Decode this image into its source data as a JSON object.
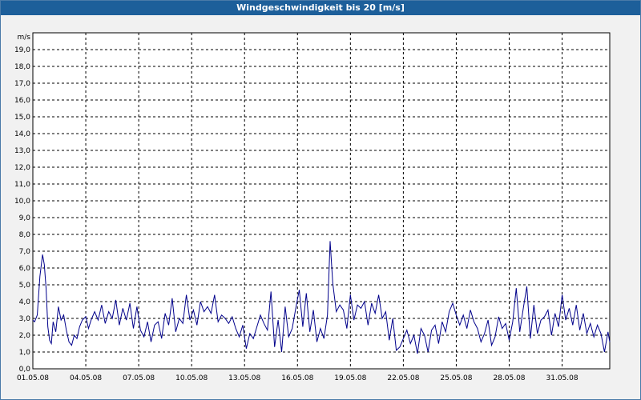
{
  "window": {
    "title": "Windgeschwindigkeit bis 20 [m/s]"
  },
  "chart_data": {
    "type": "line",
    "title": "Windgeschwindigkeit bis 20 [m/s]",
    "ylabel": "m/s",
    "xlabel": "",
    "ylim": [
      0,
      20
    ],
    "xlim_days": [
      0,
      32.7
    ],
    "grid": true,
    "line_color": "#00008b",
    "y_ticks": [
      "0,0",
      "1,0",
      "2,0",
      "3,0",
      "4,0",
      "5,0",
      "6,0",
      "7,0",
      "8,0",
      "9,0",
      "10,0",
      "11,0",
      "12,0",
      "13,0",
      "14,0",
      "15,0",
      "16,0",
      "17,0",
      "18,0",
      "19,0"
    ],
    "x_ticks": [
      "01.05.08",
      "04.05.08",
      "07.05.08",
      "10.05.08",
      "13.05.08",
      "16.05.08",
      "19.05.08",
      "22.05.08",
      "25.05.08",
      "28.05.08",
      "31.05.08"
    ],
    "x_tick_days": [
      0,
      3,
      6,
      9,
      12,
      15,
      18,
      21,
      24,
      27,
      30
    ],
    "series": [
      {
        "x": [
          0,
          0.1,
          0.25,
          0.4,
          0.55,
          0.65,
          0.75,
          0.85,
          0.95,
          1.05,
          1.15,
          1.3,
          1.45,
          1.6,
          1.75,
          1.9,
          2.05,
          2.2,
          2.35,
          2.5,
          2.65,
          2.8,
          3.0,
          3.15,
          3.3,
          3.5,
          3.7,
          3.9,
          4.1,
          4.3,
          4.5,
          4.7,
          4.9,
          5.1,
          5.3,
          5.5,
          5.7,
          5.9,
          6.1,
          6.3,
          6.5,
          6.7,
          6.9,
          7.1,
          7.3,
          7.5,
          7.7,
          7.9,
          8.1,
          8.3,
          8.5,
          8.7,
          8.9,
          9.1,
          9.3,
          9.5,
          9.7,
          9.9,
          10.1,
          10.3,
          10.5,
          10.7,
          10.9,
          11.1,
          11.3,
          11.5,
          11.7,
          11.9,
          12.1,
          12.3,
          12.5,
          12.7,
          12.9,
          13.1,
          13.3,
          13.5,
          13.7,
          13.9,
          14.1,
          14.3,
          14.5,
          14.7,
          14.9,
          15.1,
          15.3,
          15.5,
          15.7,
          15.9,
          16.1,
          16.3,
          16.5,
          16.7,
          16.85,
          17.0,
          17.2,
          17.4,
          17.6,
          17.8,
          18.0,
          18.2,
          18.4,
          18.6,
          18.8,
          19.0,
          19.2,
          19.4,
          19.6,
          19.8,
          20.0,
          20.2,
          20.4,
          20.6,
          20.8,
          21.0,
          21.2,
          21.4,
          21.6,
          21.8,
          22.0,
          22.2,
          22.4,
          22.6,
          22.8,
          23.0,
          23.2,
          23.4,
          23.6,
          23.8,
          24.0,
          24.2,
          24.4,
          24.6,
          24.8,
          25.0,
          25.2,
          25.4,
          25.6,
          25.8,
          26.0,
          26.2,
          26.4,
          26.6,
          26.8,
          27.0,
          27.2,
          27.4,
          27.6,
          27.8,
          28.0,
          28.2,
          28.4,
          28.6,
          28.8,
          29.0,
          29.2,
          29.4,
          29.6,
          29.8,
          30.0,
          30.2,
          30.4,
          30.6,
          30.8,
          31.0,
          31.2,
          31.4,
          31.6,
          31.8,
          32.0,
          32.2,
          32.4,
          32.6,
          32.7
        ],
        "values": [
          2.9,
          2.8,
          3.2,
          5.5,
          6.8,
          6.2,
          4.8,
          2.5,
          1.7,
          1.5,
          2.8,
          2.2,
          3.7,
          2.9,
          3.2,
          2.3,
          1.6,
          1.4,
          2.0,
          1.8,
          2.5,
          2.9,
          3.1,
          2.4,
          2.9,
          3.4,
          2.9,
          3.8,
          2.7,
          3.4,
          3.0,
          4.1,
          2.6,
          3.6,
          2.9,
          3.9,
          2.4,
          3.7,
          2.3,
          1.9,
          2.8,
          1.6,
          2.6,
          2.8,
          1.8,
          3.3,
          2.6,
          4.2,
          2.2,
          3.0,
          2.7,
          4.4,
          2.9,
          3.5,
          2.6,
          4.0,
          3.4,
          3.7,
          3.3,
          4.4,
          2.8,
          3.2,
          3.0,
          2.7,
          3.1,
          2.4,
          1.9,
          2.6,
          1.2,
          2.1,
          1.8,
          2.5,
          3.2,
          2.7,
          2.3,
          4.6,
          1.3,
          2.9,
          1.0,
          3.7,
          1.9,
          2.4,
          3.6,
          4.7,
          2.5,
          4.5,
          2.2,
          3.5,
          1.6,
          2.4,
          1.8,
          3.2,
          7.6,
          5.1,
          3.4,
          3.8,
          3.5,
          2.4,
          4.4,
          2.9,
          3.8,
          3.6,
          4.0,
          2.6,
          3.9,
          3.3,
          4.4,
          3.0,
          3.4,
          1.7,
          3.0,
          1.1,
          1.3,
          1.8,
          2.3,
          1.5,
          2.0,
          0.9,
          2.4,
          2.0,
          1.0,
          2.3,
          2.6,
          1.5,
          2.8,
          2.2,
          3.4,
          3.9,
          3.2,
          2.6,
          3.2,
          2.4,
          3.5,
          2.8,
          2.4,
          1.6,
          2.1,
          2.9,
          1.4,
          1.9,
          3.1,
          2.4,
          2.7,
          1.7,
          2.8,
          4.8,
          2.2,
          3.6,
          4.9,
          1.8,
          3.8,
          2.1,
          2.9,
          3.1,
          3.5,
          2.0,
          3.3,
          2.5,
          4.4,
          2.9,
          3.6,
          2.6,
          3.8,
          2.3,
          3.3,
          2.1,
          2.7,
          1.9,
          2.6,
          2.1,
          1.0,
          2.2,
          1.6
        ]
      }
    ]
  }
}
